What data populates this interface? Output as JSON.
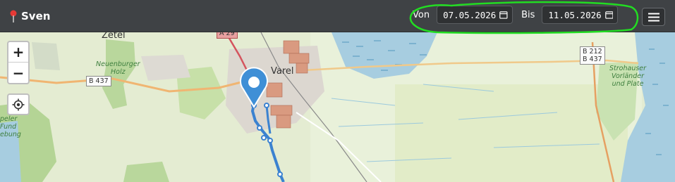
{
  "header": {
    "app_icon": "red-map-pin-icon",
    "title": "Sven",
    "from_label": "Von",
    "from_value": "07.05.2026",
    "to_label": "Bis",
    "to_value": "11.05.2026",
    "menu_icon": "hamburger-menu-icon"
  },
  "map": {
    "zoom_in_label": "+",
    "zoom_out_label": "−",
    "locate_icon": "crosshair-locate-icon",
    "labels": {
      "zetel": "Zetel",
      "varel": "Varel",
      "neuenburger_line1": "Neuenburger",
      "neuenburger_line2": "Holz",
      "strohauser_line1": "Strohauser",
      "strohauser_line2": "Vorländer",
      "strohauser_line3": "und Plate",
      "left_forest_line1": "peler",
      "left_forest_line2": "Fund",
      "left_forest_line3": "ebung"
    },
    "shields": {
      "b437_left": "B 437",
      "b212": "B 212",
      "b437_right": "B 437",
      "top_route": "A 29"
    },
    "colors": {
      "track": "#3b82d0",
      "annotation": "#22dd22",
      "water": "#a7cde0"
    }
  }
}
